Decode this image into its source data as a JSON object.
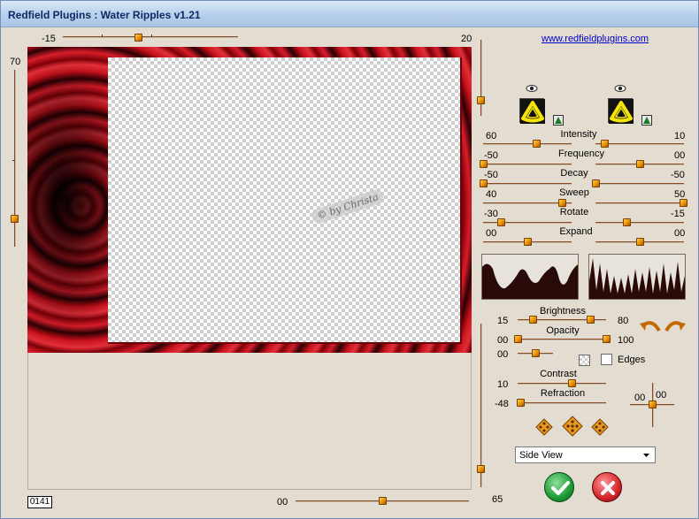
{
  "window": {
    "title": "Redfield Plugins : Water Ripples v1.21"
  },
  "link": "www.redfieldplugins.com",
  "preview": {
    "watermark": "© by Christa",
    "counter": "0141"
  },
  "top_slider": {
    "min_label": "-15",
    "max_label": "20"
  },
  "left_slider": {
    "label": "70"
  },
  "right_slider": {
    "bottom_label": "65"
  },
  "bottom_slider": {
    "label": "00"
  },
  "params": [
    {
      "name": "Intensity",
      "left": "60",
      "right": "10"
    },
    {
      "name": "Frequency",
      "left": "-50",
      "right": "00"
    },
    {
      "name": "Decay",
      "left": "-50",
      "right": "-50"
    },
    {
      "name": "Sweep",
      "left": "40",
      "right": "50"
    },
    {
      "name": "Rotate",
      "left": "-30",
      "right": "-15"
    },
    {
      "name": "Expand",
      "left": "00",
      "right": "00"
    }
  ],
  "brightness": {
    "label": "Brightness",
    "left": "15",
    "right": "80"
  },
  "opacity": {
    "label": "Opacity",
    "left": "00",
    "right": "100"
  },
  "unnamed": {
    "left": "00"
  },
  "edges": {
    "label": "Edges",
    "checked": false
  },
  "contrast": {
    "label": "Contrast",
    "value": "10"
  },
  "refraction": {
    "label": "Refraction",
    "value": "-48"
  },
  "xy": {
    "x": "00",
    "y": "00"
  },
  "view_select": {
    "value": "Side View",
    "options": [
      "Side View"
    ]
  },
  "colors": {
    "accent_track": "#8a4a24",
    "knob": "#f0a000",
    "ok": "#1e9b36",
    "cancel": "#d5252a"
  },
  "icons": [
    "eye-icon",
    "reset-arrows-icon",
    "dice-icon",
    "ok-check-icon",
    "cancel-x-icon",
    "checkerboard-icon",
    "chevron-down-icon"
  ]
}
